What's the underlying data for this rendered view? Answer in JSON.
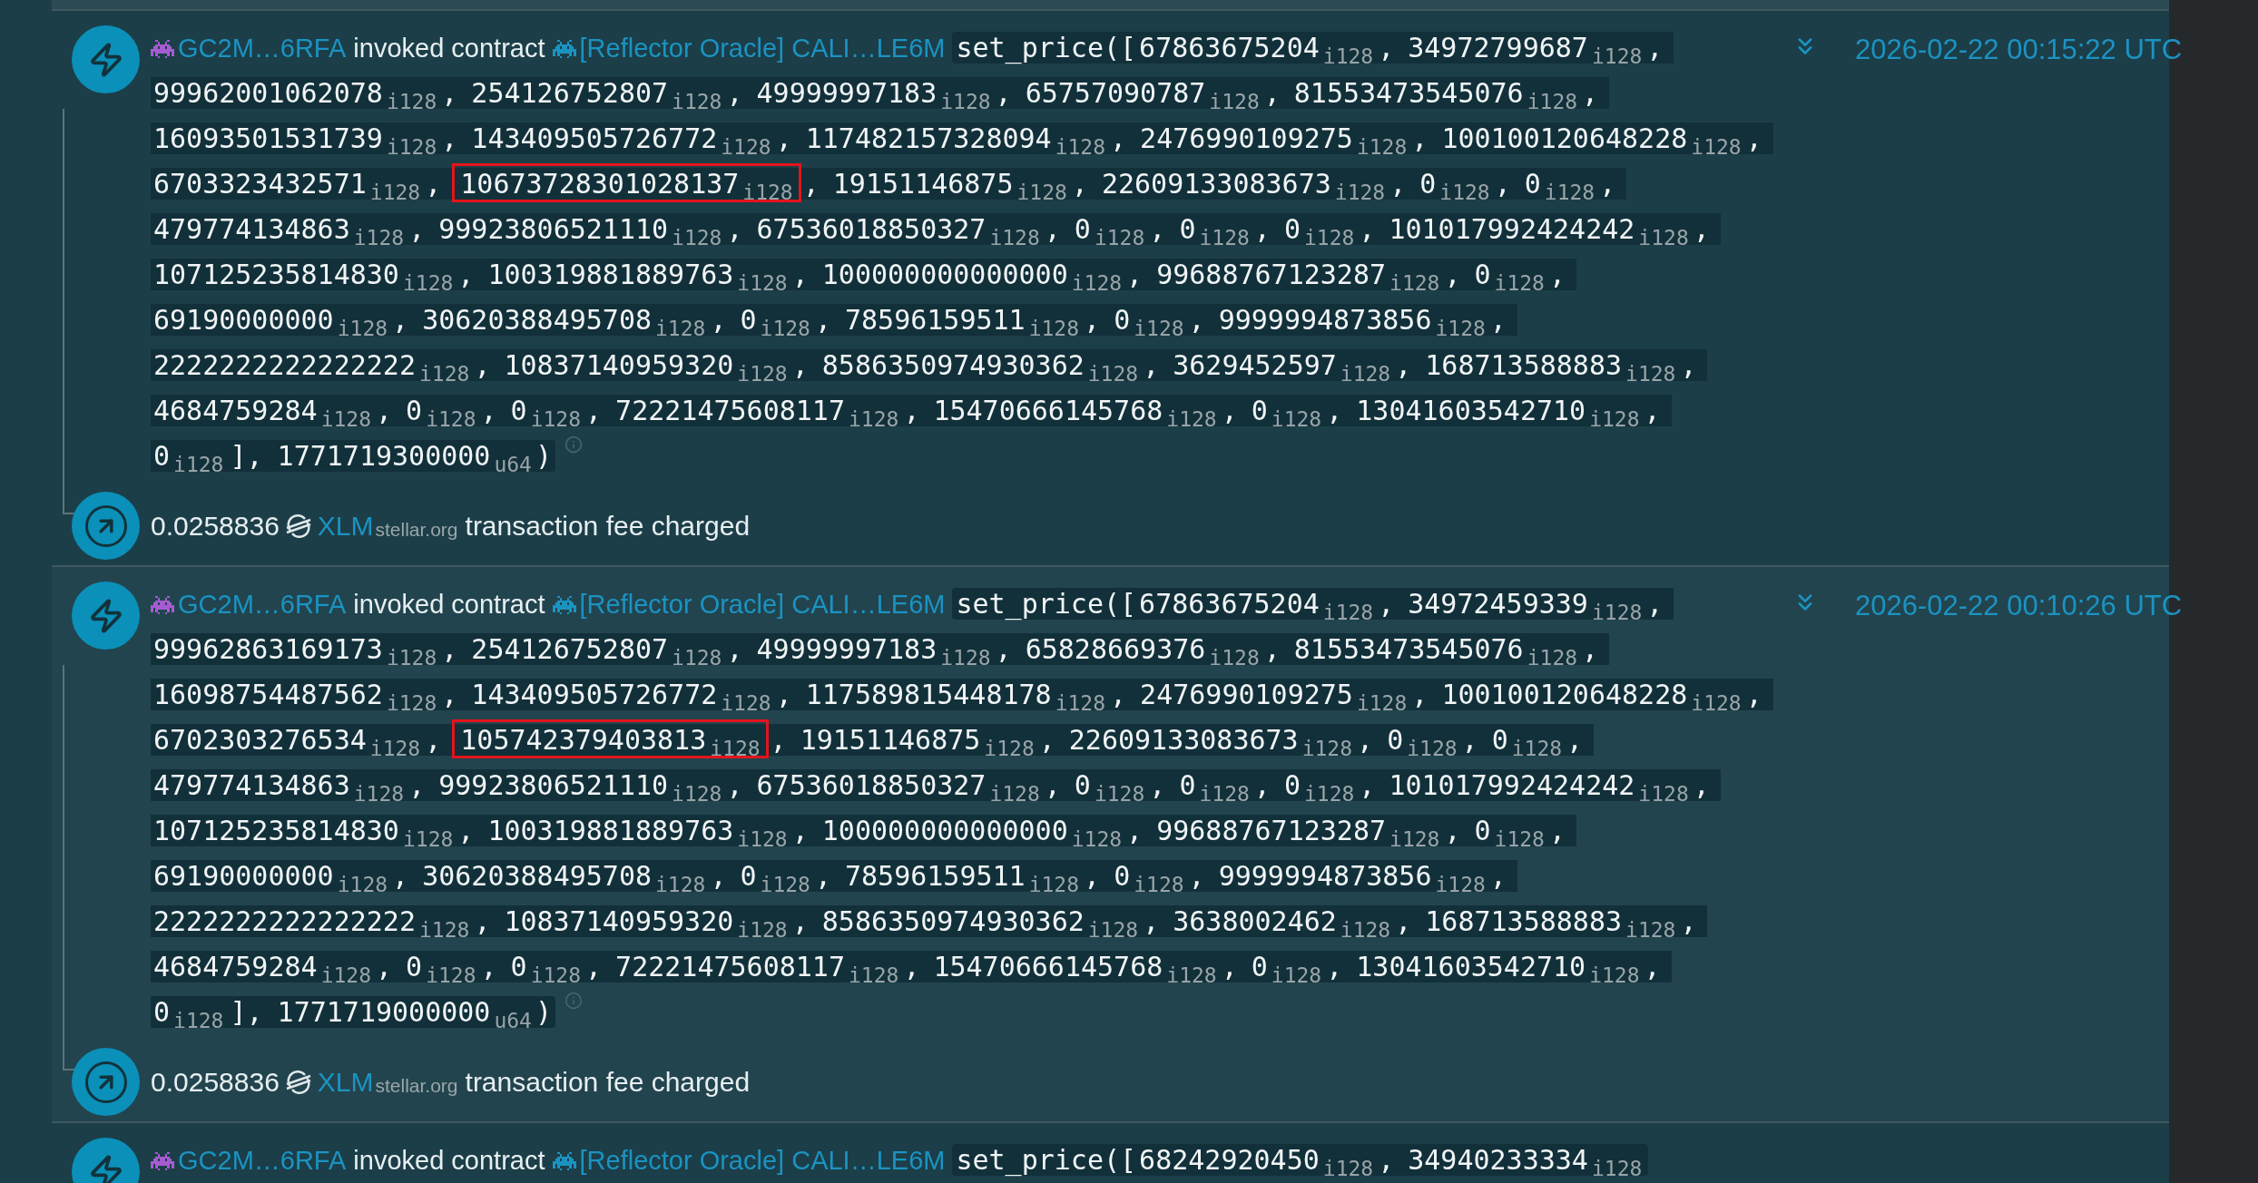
{
  "entries": [
    {
      "account": "GC2M…6RFA",
      "action": "invoked contract",
      "contract": "[Reflector Oracle] CALI…LE6M",
      "call": {
        "function": "set_price(",
        "array_open": "[",
        "separator": ",",
        "array_close": "]",
        "close": ")",
        "args": [
          {
            "value": "67863675204",
            "type": "i128",
            "highlighted": false
          },
          {
            "value": "34972799687",
            "type": "i128",
            "highlighted": false
          },
          {
            "value": "99962001062078",
            "type": "i128",
            "highlighted": false
          },
          {
            "value": "254126752807",
            "type": "i128",
            "highlighted": false
          },
          {
            "value": "49999997183",
            "type": "i128",
            "highlighted": false
          },
          {
            "value": "65757090787",
            "type": "i128",
            "highlighted": false
          },
          {
            "value": "81553473545076",
            "type": "i128",
            "highlighted": false
          },
          {
            "value": "16093501531739",
            "type": "i128",
            "highlighted": false
          },
          {
            "value": "143409505726772",
            "type": "i128",
            "highlighted": false
          },
          {
            "value": "117482157328094",
            "type": "i128",
            "highlighted": false
          },
          {
            "value": "2476990109275",
            "type": "i128",
            "highlighted": false
          },
          {
            "value": "100100120648228",
            "type": "i128",
            "highlighted": false
          },
          {
            "value": "6703323432571",
            "type": "i128",
            "highlighted": false
          },
          {
            "value": "10673728301028137",
            "type": "i128",
            "highlighted": true
          },
          {
            "value": "19151146875",
            "type": "i128",
            "highlighted": false
          },
          {
            "value": "22609133083673",
            "type": "i128",
            "highlighted": false
          },
          {
            "value": "0",
            "type": "i128",
            "highlighted": false
          },
          {
            "value": "0",
            "type": "i128",
            "highlighted": false
          },
          {
            "value": "479774134863",
            "type": "i128",
            "highlighted": false
          },
          {
            "value": "99923806521110",
            "type": "i128",
            "highlighted": false
          },
          {
            "value": "67536018850327",
            "type": "i128",
            "highlighted": false
          },
          {
            "value": "0",
            "type": "i128",
            "highlighted": false
          },
          {
            "value": "0",
            "type": "i128",
            "highlighted": false
          },
          {
            "value": "0",
            "type": "i128",
            "highlighted": false
          },
          {
            "value": "101017992424242",
            "type": "i128",
            "highlighted": false
          },
          {
            "value": "107125235814830",
            "type": "i128",
            "highlighted": false
          },
          {
            "value": "100319881889763",
            "type": "i128",
            "highlighted": false
          },
          {
            "value": "100000000000000",
            "type": "i128",
            "highlighted": false
          },
          {
            "value": "99688767123287",
            "type": "i128",
            "highlighted": false
          },
          {
            "value": "0",
            "type": "i128",
            "highlighted": false
          },
          {
            "value": "69190000000",
            "type": "i128",
            "highlighted": false
          },
          {
            "value": "30620388495708",
            "type": "i128",
            "highlighted": false
          },
          {
            "value": "0",
            "type": "i128",
            "highlighted": false
          },
          {
            "value": "78596159511",
            "type": "i128",
            "highlighted": false
          },
          {
            "value": "0",
            "type": "i128",
            "highlighted": false
          },
          {
            "value": "9999994873856",
            "type": "i128",
            "highlighted": false
          },
          {
            "value": "2222222222222222",
            "type": "i128",
            "highlighted": false
          },
          {
            "value": "10837140959320",
            "type": "i128",
            "highlighted": false
          },
          {
            "value": "8586350974930362",
            "type": "i128",
            "highlighted": false
          },
          {
            "value": "3629452597",
            "type": "i128",
            "highlighted": false
          },
          {
            "value": "168713588883",
            "type": "i128",
            "highlighted": false
          },
          {
            "value": "4684759284",
            "type": "i128",
            "highlighted": false
          },
          {
            "value": "0",
            "type": "i128",
            "highlighted": false
          },
          {
            "value": "0",
            "type": "i128",
            "highlighted": false
          },
          {
            "value": "72221475608117",
            "type": "i128",
            "highlighted": false
          },
          {
            "value": "15470666145768",
            "type": "i128",
            "highlighted": false
          },
          {
            "value": "0",
            "type": "i128",
            "highlighted": false
          },
          {
            "value": "13041603542710",
            "type": "i128",
            "highlighted": false
          },
          {
            "value": "0",
            "type": "i128",
            "highlighted": false
          }
        ],
        "trailing_args": [
          {
            "value": "1771719300000",
            "type": "u64"
          }
        ]
      },
      "timestamp": "2026-02-22 00:15:22 UTC",
      "fee": {
        "amount": "0.0258836",
        "asset": "XLM",
        "domain": "stellar.org",
        "text": "transaction fee charged"
      }
    },
    {
      "account": "GC2M…6RFA",
      "action": "invoked contract",
      "contract": "[Reflector Oracle] CALI…LE6M",
      "call": {
        "function": "set_price(",
        "array_open": "[",
        "separator": ",",
        "array_close": "]",
        "close": ")",
        "args": [
          {
            "value": "67863675204",
            "type": "i128",
            "highlighted": false
          },
          {
            "value": "34972459339",
            "type": "i128",
            "highlighted": false
          },
          {
            "value": "99962863169173",
            "type": "i128",
            "highlighted": false
          },
          {
            "value": "254126752807",
            "type": "i128",
            "highlighted": false
          },
          {
            "value": "49999997183",
            "type": "i128",
            "highlighted": false
          },
          {
            "value": "65828669376",
            "type": "i128",
            "highlighted": false
          },
          {
            "value": "81553473545076",
            "type": "i128",
            "highlighted": false
          },
          {
            "value": "16098754487562",
            "type": "i128",
            "highlighted": false
          },
          {
            "value": "143409505726772",
            "type": "i128",
            "highlighted": false
          },
          {
            "value": "117589815448178",
            "type": "i128",
            "highlighted": false
          },
          {
            "value": "2476990109275",
            "type": "i128",
            "highlighted": false
          },
          {
            "value": "100100120648228",
            "type": "i128",
            "highlighted": false
          },
          {
            "value": "6702303276534",
            "type": "i128",
            "highlighted": false
          },
          {
            "value": "105742379403813",
            "type": "i128",
            "highlighted": true
          },
          {
            "value": "19151146875",
            "type": "i128",
            "highlighted": false
          },
          {
            "value": "22609133083673",
            "type": "i128",
            "highlighted": false
          },
          {
            "value": "0",
            "type": "i128",
            "highlighted": false
          },
          {
            "value": "0",
            "type": "i128",
            "highlighted": false
          },
          {
            "value": "479774134863",
            "type": "i128",
            "highlighted": false
          },
          {
            "value": "99923806521110",
            "type": "i128",
            "highlighted": false
          },
          {
            "value": "67536018850327",
            "type": "i128",
            "highlighted": false
          },
          {
            "value": "0",
            "type": "i128",
            "highlighted": false
          },
          {
            "value": "0",
            "type": "i128",
            "highlighted": false
          },
          {
            "value": "0",
            "type": "i128",
            "highlighted": false
          },
          {
            "value": "101017992424242",
            "type": "i128",
            "highlighted": false
          },
          {
            "value": "107125235814830",
            "type": "i128",
            "highlighted": false
          },
          {
            "value": "100319881889763",
            "type": "i128",
            "highlighted": false
          },
          {
            "value": "100000000000000",
            "type": "i128",
            "highlighted": false
          },
          {
            "value": "99688767123287",
            "type": "i128",
            "highlighted": false
          },
          {
            "value": "0",
            "type": "i128",
            "highlighted": false
          },
          {
            "value": "69190000000",
            "type": "i128",
            "highlighted": false
          },
          {
            "value": "30620388495708",
            "type": "i128",
            "highlighted": false
          },
          {
            "value": "0",
            "type": "i128",
            "highlighted": false
          },
          {
            "value": "78596159511",
            "type": "i128",
            "highlighted": false
          },
          {
            "value": "0",
            "type": "i128",
            "highlighted": false
          },
          {
            "value": "9999994873856",
            "type": "i128",
            "highlighted": false
          },
          {
            "value": "2222222222222222",
            "type": "i128",
            "highlighted": false
          },
          {
            "value": "10837140959320",
            "type": "i128",
            "highlighted": false
          },
          {
            "value": "8586350974930362",
            "type": "i128",
            "highlighted": false
          },
          {
            "value": "3638002462",
            "type": "i128",
            "highlighted": false
          },
          {
            "value": "168713588883",
            "type": "i128",
            "highlighted": false
          },
          {
            "value": "4684759284",
            "type": "i128",
            "highlighted": false
          },
          {
            "value": "0",
            "type": "i128",
            "highlighted": false
          },
          {
            "value": "0",
            "type": "i128",
            "highlighted": false
          },
          {
            "value": "72221475608117",
            "type": "i128",
            "highlighted": false
          },
          {
            "value": "15470666145768",
            "type": "i128",
            "highlighted": false
          },
          {
            "value": "0",
            "type": "i128",
            "highlighted": false
          },
          {
            "value": "13041603542710",
            "type": "i128",
            "highlighted": false
          },
          {
            "value": "0",
            "type": "i128",
            "highlighted": false
          }
        ],
        "trailing_args": [
          {
            "value": "1771719000000",
            "type": "u64"
          }
        ]
      },
      "timestamp": "2026-02-22 00:10:26 UTC",
      "fee": {
        "amount": "0.0258836",
        "asset": "XLM",
        "domain": "stellar.org",
        "text": "transaction fee charged"
      }
    },
    {
      "account": "GC2M…6RFA",
      "action": "invoked contract",
      "contract": "[Reflector Oracle] CALI…LE6M",
      "call": {
        "function": "set_price(",
        "array_open": "[",
        "separator": ",",
        "args": [
          {
            "value": "68242920450",
            "type": "i128",
            "highlighted": false
          },
          {
            "value": "34940233334",
            "type": "i128",
            "highlighted": false
          }
        ]
      }
    }
  ]
}
